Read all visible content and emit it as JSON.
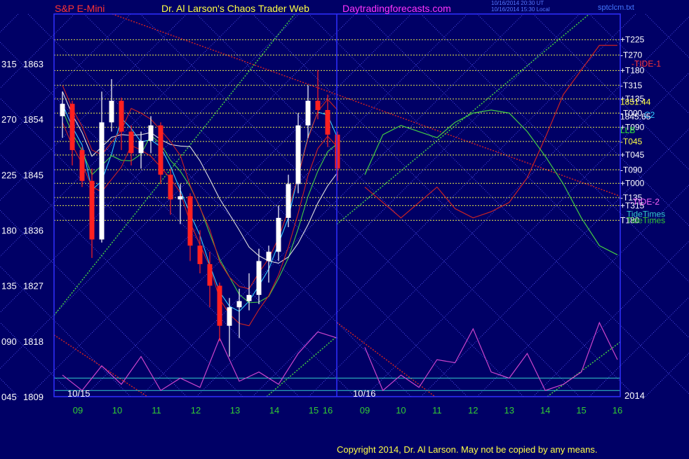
{
  "header": {
    "instrument": "S&P E-Mini",
    "site_title": "Dr. Al Larson's Chaos Trader Web",
    "url": "Daytradingforecasts.com",
    "timestamp_1": "10/16/2014 20:30 UT",
    "timestamp_2": "10/16/2014 15:30 Local",
    "tag": "sptclcm.txt"
  },
  "footer": {
    "copyright": "Copyright 2014, Dr. Al Larson. May not be copied by any means."
  },
  "colors": {
    "background": "#000066",
    "grid": "#5a5aff",
    "frame": "#3030ff",
    "yellow_lines": "#e8e84a",
    "candle_up": "#ffffff",
    "candle_down": "#ff2020",
    "ma_fast": "#33ccff",
    "ma_green": "#44cc44",
    "ma_red": "#cc2222",
    "ma_white": "#dddddd",
    "tide": "#cc44cc",
    "tide_times": "#33cccc"
  },
  "chart_data": {
    "type": "line",
    "title": "S&P E-Mini",
    "y_axis_left": {
      "angles": [
        "315",
        "270",
        "225",
        "180",
        "135",
        "090",
        "045"
      ],
      "prices": [
        "1863",
        "1854",
        "1845",
        "1836",
        "1827",
        "1818",
        "1809"
      ],
      "ylim": [
        1809,
        1863
      ]
    },
    "x_axis": {
      "day_1": {
        "label": "10/15",
        "hours": [
          "09",
          "10",
          "11",
          "12",
          "13",
          "14",
          "15",
          "16"
        ]
      },
      "day_2": {
        "label": "10/16",
        "hours": [
          "09",
          "10",
          "11",
          "12",
          "13",
          "14",
          "15",
          "16"
        ]
      },
      "year": "2014"
    },
    "right_labels": [
      {
        "text": "+T225",
        "price": 1866.9,
        "color": "#ffffff"
      },
      {
        "text": "-T270",
        "price": 1864.4,
        "color": "#ffffff"
      },
      {
        "text": "-TIDE-1",
        "price": 1863.0,
        "color": "#ff3333"
      },
      {
        "text": "+T180",
        "price": 1861.9,
        "color": "#ffffff"
      },
      {
        "text": "-T315",
        "price": 1859.5,
        "color": "#ffffff"
      },
      {
        "text": "+T135",
        "price": 1857.3,
        "color": "#ffffff"
      },
      {
        "text": "1851.44",
        "price": 1856.8,
        "color": "#ffff44"
      },
      {
        "text": "-T000",
        "price": 1855.0,
        "color": "#ffffff"
      },
      {
        "text": "C2",
        "price": 1854.7,
        "color": "#33ccff"
      },
      {
        "text": "1845.65",
        "price": 1854.4,
        "color": "#ffffff"
      },
      {
        "text": "+T090",
        "price": 1852.7,
        "color": "#ffffff"
      },
      {
        "text": "LLB",
        "price": 1852.2,
        "color": "#33ee33"
      },
      {
        "text": "-T045",
        "price": 1850.4,
        "color": "#ffff44"
      },
      {
        "text": "+T045",
        "price": 1848.2,
        "color": "#ffffff"
      },
      {
        "text": "-T090",
        "price": 1845.8,
        "color": "#ffffff"
      },
      {
        "text": "+T000",
        "price": 1843.6,
        "color": "#ffffff"
      },
      {
        "text": "-T135",
        "price": 1841.3,
        "color": "#ffffff"
      },
      {
        "text": "-TIDE-2",
        "price": 1840.6,
        "color": "#ff66ff"
      },
      {
        "text": "+T315",
        "price": 1840.0,
        "color": "#ffffff"
      },
      {
        "text": "TideTimes",
        "price": 1838.6,
        "color": "#33cccc"
      },
      {
        "text": "T180",
        "price": 1837.6,
        "color": "#ffffff"
      },
      {
        "text": "TideTimes",
        "price": 1837.6,
        "color": "#33cc33"
      }
    ],
    "price_series": {
      "name": "S&P E-Mini",
      "day_1": [
        [
          9.0,
          1854.5,
          1858.5,
          1851.0,
          1856.5
        ],
        [
          9.25,
          1856.5,
          1857.0,
          1846.5,
          1849.0
        ],
        [
          9.5,
          1849.0,
          1849.5,
          1843.0,
          1844.0
        ],
        [
          9.75,
          1844.0,
          1846.0,
          1831.5,
          1834.5
        ],
        [
          10.0,
          1834.5,
          1858.5,
          1834.0,
          1853.5
        ],
        [
          10.25,
          1853.5,
          1860.5,
          1852.0,
          1857.0
        ],
        [
          10.5,
          1857.0,
          1857.5,
          1849.0,
          1852.0
        ],
        [
          10.75,
          1852.0,
          1853.0,
          1846.5,
          1848.5
        ],
        [
          11.0,
          1848.5,
          1852.0,
          1846.0,
          1850.5
        ],
        [
          11.25,
          1850.5,
          1854.5,
          1848.5,
          1853.0
        ],
        [
          11.5,
          1853.0,
          1853.5,
          1843.5,
          1845.0
        ],
        [
          11.75,
          1845.0,
          1846.0,
          1838.5,
          1841.0
        ],
        [
          12.0,
          1841.0,
          1843.5,
          1837.0,
          1841.5
        ],
        [
          12.25,
          1841.5,
          1842.0,
          1831.0,
          1833.5
        ],
        [
          12.5,
          1833.5,
          1836.0,
          1829.0,
          1830.5
        ],
        [
          12.75,
          1830.5,
          1832.5,
          1823.5,
          1827.0
        ],
        [
          13.0,
          1827.0,
          1827.5,
          1818.0,
          1820.5
        ],
        [
          13.25,
          1820.5,
          1825.0,
          1815.5,
          1823.5
        ],
        [
          13.5,
          1823.5,
          1826.5,
          1818.5,
          1824.5
        ],
        [
          13.75,
          1824.5,
          1829.0,
          1823.0,
          1825.5
        ],
        [
          14.0,
          1825.5,
          1833.0,
          1824.0,
          1831.0
        ],
        [
          14.25,
          1831.0,
          1833.5,
          1827.5,
          1832.5
        ],
        [
          14.5,
          1832.5,
          1840.0,
          1831.0,
          1838.0
        ],
        [
          14.75,
          1838.0,
          1845.0,
          1836.5,
          1843.5
        ],
        [
          15.0,
          1843.5,
          1855.0,
          1842.0,
          1853.0
        ],
        [
          15.25,
          1853.0,
          1859.5,
          1851.0,
          1857.0
        ],
        [
          15.5,
          1857.0,
          1862.0,
          1854.0,
          1855.5
        ],
        [
          15.75,
          1855.5,
          1858.0,
          1849.5,
          1851.5
        ],
        [
          16.0,
          1851.5,
          1852.0,
          1844.0,
          1846.0
        ]
      ]
    },
    "forecast_series": [
      {
        "color": "#cc2222",
        "day_2": [
          [
            9.0,
            1843.0
          ],
          [
            9.5,
            1840.5
          ],
          [
            10.0,
            1838.0
          ],
          [
            10.5,
            1840.5
          ],
          [
            11.0,
            1843.0
          ],
          [
            11.5,
            1839.5
          ],
          [
            12.0,
            1838.0
          ],
          [
            12.5,
            1839.0
          ],
          [
            13.0,
            1840.5
          ],
          [
            13.5,
            1844.5
          ],
          [
            14.0,
            1851.0
          ],
          [
            14.5,
            1858.0
          ],
          [
            15.0,
            1862.0
          ],
          [
            15.5,
            1866.0
          ],
          [
            16.0,
            1866.0
          ]
        ]
      },
      {
        "color": "#44cc44",
        "day_2": [
          [
            9.0,
            1845.0
          ],
          [
            9.5,
            1851.5
          ],
          [
            10.0,
            1853.0
          ],
          [
            10.5,
            1852.0
          ],
          [
            11.0,
            1851.0
          ],
          [
            11.5,
            1853.5
          ],
          [
            12.0,
            1855.0
          ],
          [
            12.5,
            1855.5
          ],
          [
            13.0,
            1855.0
          ],
          [
            13.5,
            1852.0
          ],
          [
            14.0,
            1848.0
          ],
          [
            14.5,
            1843.5
          ],
          [
            15.0,
            1838.0
          ],
          [
            15.5,
            1833.5
          ],
          [
            16.0,
            1832.0
          ]
        ]
      }
    ],
    "tide_series": {
      "color": "#cc44cc",
      "day_1": [
        [
          9.0,
          1812.5
        ],
        [
          9.5,
          1810.0
        ],
        [
          10.0,
          1814.0
        ],
        [
          10.5,
          1811.0
        ],
        [
          11.0,
          1815.5
        ],
        [
          11.5,
          1810.0
        ],
        [
          12.0,
          1812.0
        ],
        [
          12.5,
          1810.5
        ],
        [
          13.0,
          1818.5
        ],
        [
          13.5,
          1811.5
        ],
        [
          14.0,
          1813.0
        ],
        [
          14.5,
          1811.0
        ],
        [
          15.0,
          1816.0
        ],
        [
          15.5,
          1819.5
        ],
        [
          16.0,
          1818.5
        ]
      ],
      "day_2": [
        [
          9.0,
          1817.0
        ],
        [
          9.5,
          1810.0
        ],
        [
          10.0,
          1812.5
        ],
        [
          10.5,
          1810.5
        ],
        [
          11.0,
          1815.0
        ],
        [
          11.5,
          1814.5
        ],
        [
          12.0,
          1820.0
        ],
        [
          12.5,
          1813.0
        ],
        [
          13.0,
          1812.0
        ],
        [
          13.5,
          1816.0
        ],
        [
          14.0,
          1810.0
        ],
        [
          14.5,
          1811.0
        ],
        [
          15.0,
          1813.0
        ],
        [
          15.5,
          1821.0
        ],
        [
          16.0,
          1815.0
        ]
      ]
    }
  }
}
